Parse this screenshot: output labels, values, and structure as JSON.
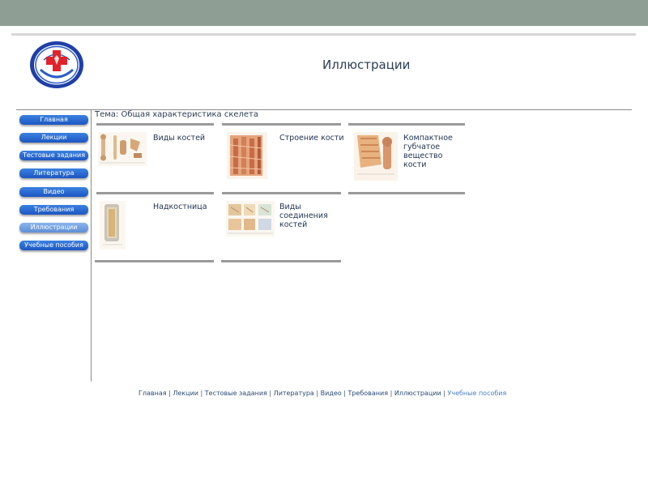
{
  "header": {
    "title": "Иллюстрации"
  },
  "nav": [
    {
      "label": "Главная",
      "active": false
    },
    {
      "label": "Лекции",
      "active": false
    },
    {
      "label": "Тестовые задания",
      "active": false
    },
    {
      "label": "Литература",
      "active": false
    },
    {
      "label": "Видео",
      "active": false
    },
    {
      "label": "Требования",
      "active": false
    },
    {
      "label": "Иллюстрации",
      "active": true
    },
    {
      "label": "Учебные пособия",
      "active": false
    }
  ],
  "topic": "Тема: Общая характеристика скелета",
  "cards": [
    {
      "label_lines": [
        "Виды костей"
      ]
    },
    {
      "label_lines": [
        "Строение кости"
      ]
    },
    {
      "label_lines": [
        "Компактное",
        "губчатое",
        "вещество",
        "кости"
      ]
    },
    {
      "label_lines": [
        "Надкостница"
      ]
    },
    {
      "label_lines": [
        "Виды",
        "соединения",
        "костей"
      ]
    }
  ],
  "footer": {
    "links": [
      "Главная",
      "Лекции",
      "Тестовые задания",
      "Литература",
      "Видео",
      "Требования",
      "Иллюстрации",
      "Учебные пособия"
    ],
    "separator": "|"
  },
  "colors": {
    "nav_button": "#2a6ad1",
    "nav_active": "#7aa6e6",
    "top_bar": "#8e9e94"
  }
}
